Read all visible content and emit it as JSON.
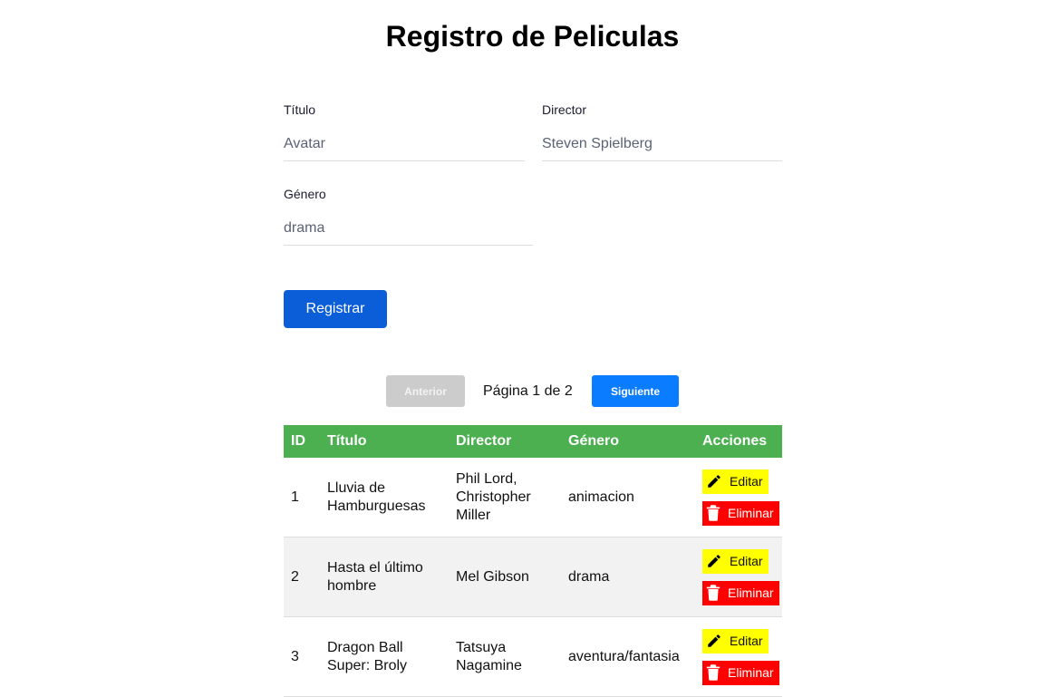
{
  "page": {
    "title": "Registro de Peliculas"
  },
  "form": {
    "titulo": {
      "label": "Título",
      "value": "Avatar"
    },
    "director": {
      "label": "Director",
      "value": "Steven Spielberg"
    },
    "genero": {
      "label": "Género",
      "value": "drama"
    },
    "submit_label": "Registrar"
  },
  "pagination": {
    "prev_label": "Anterior",
    "page_info": "Página 1 de 2",
    "next_label": "Siguiente"
  },
  "table": {
    "headers": [
      "ID",
      "Título",
      "Director",
      "Género",
      "Acciones"
    ],
    "rows": [
      {
        "id": "1",
        "titulo": "Lluvia de Hamburguesas",
        "director": "Phil Lord, Christopher Miller",
        "genero": "animacion"
      },
      {
        "id": "2",
        "titulo": "Hasta el último hombre",
        "director": "Mel Gibson",
        "genero": "drama"
      },
      {
        "id": "3",
        "titulo": "Dragon Ball Super: Broly",
        "director": "Tatsuya Nagamine",
        "genero": "aventura/fantasia"
      }
    ],
    "edit_label": "Editar",
    "delete_label": "Eliminar"
  },
  "colors": {
    "primary": "#0b5ed7",
    "next_button": "#0a7cff",
    "table_header": "#4caf50",
    "edit": "#ffff00",
    "delete": "#ff0000"
  }
}
